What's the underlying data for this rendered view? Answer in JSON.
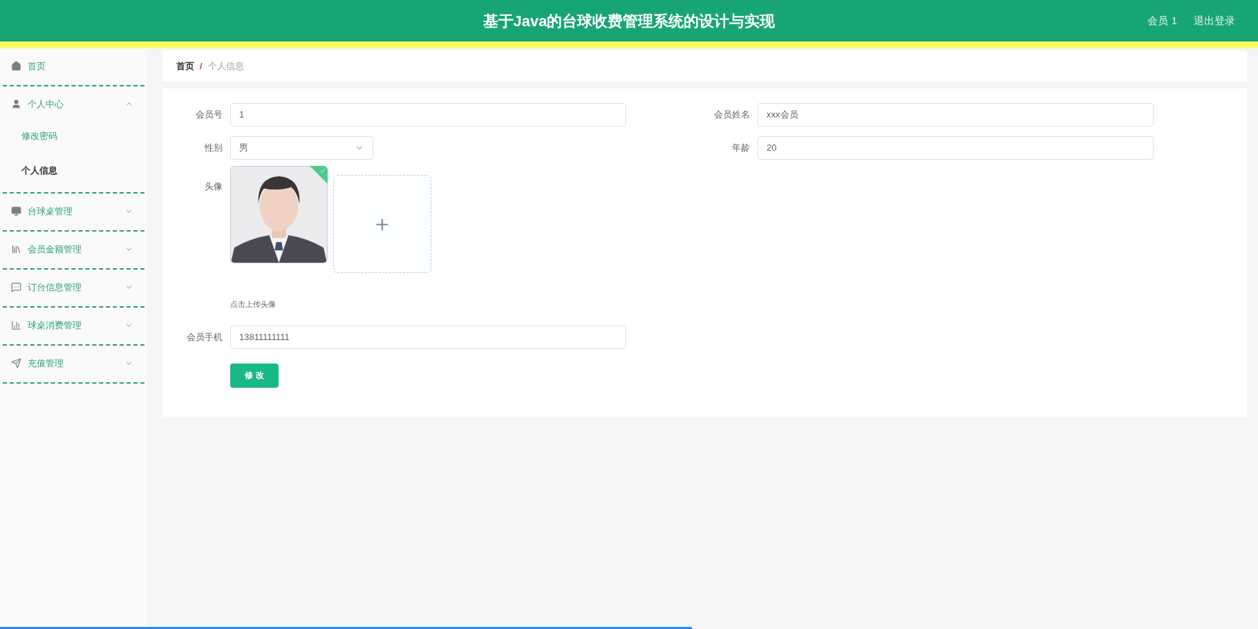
{
  "header": {
    "title": "基于Java的台球收费管理系统的设计与实现",
    "user": "会员 1",
    "logout": "退出登录"
  },
  "sidebar": {
    "items": [
      {
        "label": "首页",
        "has_children": false
      },
      {
        "label": "个人中心",
        "has_children": true,
        "expanded": true,
        "children": [
          {
            "label": "修改密码",
            "selected": false
          },
          {
            "label": "个人信息",
            "selected": true
          }
        ]
      },
      {
        "label": "台球桌管理",
        "has_children": true,
        "expanded": false
      },
      {
        "label": "会员金额管理",
        "has_children": true,
        "expanded": false
      },
      {
        "label": "订台信息管理",
        "has_children": true,
        "expanded": false
      },
      {
        "label": "球桌消费管理",
        "has_children": true,
        "expanded": false
      },
      {
        "label": "充值管理",
        "has_children": true,
        "expanded": false
      }
    ]
  },
  "breadcrumb": {
    "home": "首页",
    "separator": "/",
    "current": "个人信息"
  },
  "form": {
    "member_no": {
      "label": "会员号",
      "value": "1"
    },
    "member_name": {
      "label": "会员姓名",
      "value": "xxx会员"
    },
    "gender": {
      "label": "性别",
      "value": "男"
    },
    "age": {
      "label": "年龄",
      "value": "20"
    },
    "avatar": {
      "label": "头像",
      "uploaded": true,
      "hint": "点击上传头像",
      "add": "+"
    },
    "phone": {
      "label": "会员手机",
      "value": "13811111111"
    },
    "submit": "修 改"
  },
  "playback_bar": {
    "level": 0.55
  }
}
